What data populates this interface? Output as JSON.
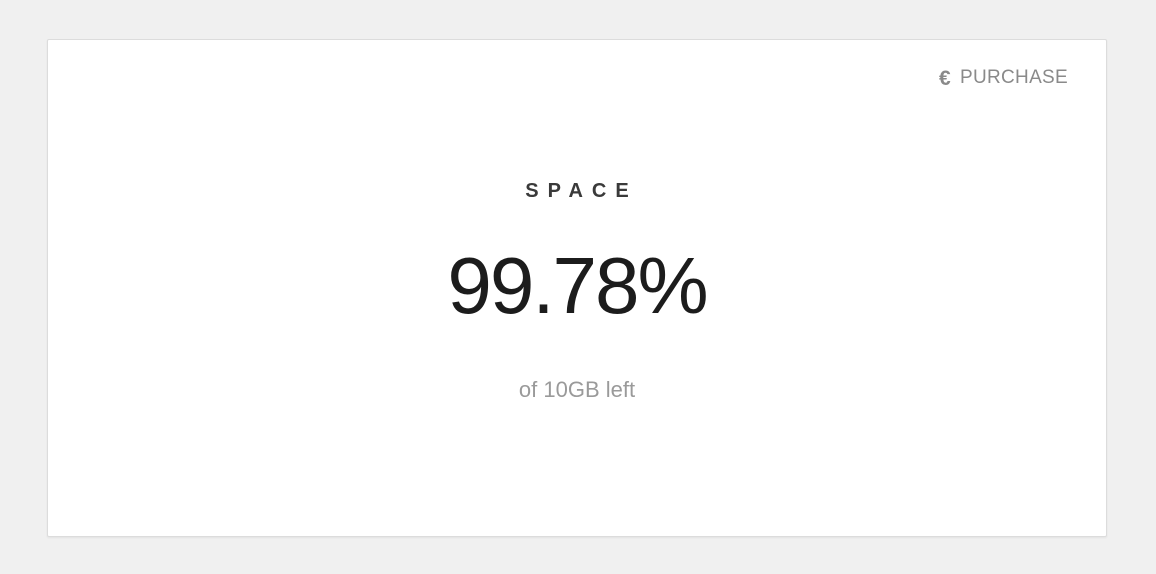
{
  "card": {
    "action": {
      "icon": "euro-icon",
      "icon_glyph": "€",
      "label": "PURCHASE"
    },
    "title": "SPACE",
    "value": "99.78%",
    "subtitle": "of 10GB left"
  },
  "colors": {
    "background": "#f0f0f0",
    "card": "#ffffff",
    "muted_text": "#8a8a8a",
    "title_text": "#3a3a3a",
    "value_text": "#1c1c1c"
  }
}
